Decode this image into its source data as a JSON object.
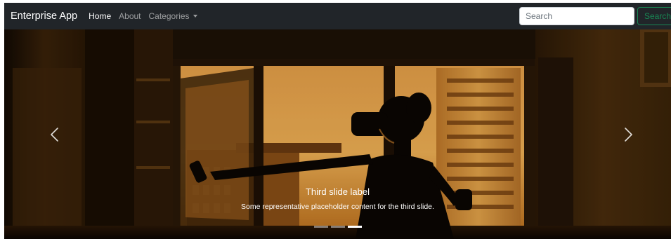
{
  "navbar": {
    "brand": "Enterprise App",
    "links": [
      {
        "label": "Home",
        "active": true
      },
      {
        "label": "About",
        "active": false
      },
      {
        "label": "Categories",
        "active": false,
        "dropdown": true
      }
    ],
    "search": {
      "placeholder": "Search",
      "value": "",
      "button_label": "Search"
    }
  },
  "carousel": {
    "active_slide": 3,
    "slide_count": 3,
    "caption": {
      "title": "Third slide label",
      "text": "Some representative placeholder content for the third slide."
    },
    "controls": {
      "prev_icon": "chevron-left-icon",
      "next_icon": "chevron-right-icon"
    }
  },
  "colors": {
    "navbar_bg": "#212529",
    "search_button": "#198754",
    "sky_warm": "#f0a03a"
  }
}
